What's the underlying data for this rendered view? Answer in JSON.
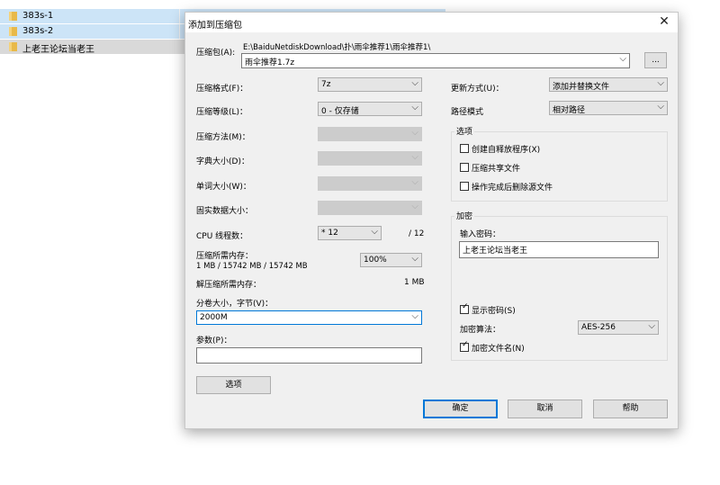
{
  "explorer": {
    "files": [
      {
        "name": "383s-1"
      },
      {
        "name": "383s-2"
      },
      {
        "name": "上老王论坛当老王"
      }
    ]
  },
  "dialog": {
    "title": "添加到压缩包",
    "archive_label": "压缩包(A):",
    "archive_path": "E:\\BaiduNetdiskDownload\\扑\\雨伞推荐1\\雨伞推荐1\\",
    "archive_name": "雨伞推荐1.7z",
    "browse_label": "...",
    "format_label": "压缩格式(F)：",
    "format_value": "7z",
    "level_label": "压缩等级(L)：",
    "level_value": "0 - 仅存储",
    "method_label": "压缩方法(M)：",
    "dict_label": "字典大小(D)：",
    "word_label": "单词大小(W)：",
    "solid_label": "固实数据大小：",
    "cpu_label": "CPU 线程数：",
    "cpu_value": "* 12",
    "cpu_max": "/ 12",
    "mem_comp_label": "压缩所需内存：",
    "mem_comp_value": "1 MB / 15742 MB / 15742 MB",
    "mem_percent": "100%",
    "mem_decomp_label": "解压缩所需内存：",
    "mem_decomp_value": "1 MB",
    "split_label": "分卷大小，字节(V)：",
    "split_value": "2000M",
    "params_label": "参数(P)：",
    "params_value": "",
    "options_btn": "选项",
    "update_label": "更新方式(U)：",
    "update_value": "添加并替换文件",
    "path_label": "路径模式",
    "path_value": "相对路径",
    "options_group": "选项",
    "opt_sfx": "创建自释放程序(X)",
    "opt_shared": "压缩共享文件",
    "opt_delete": "操作完成后删除源文件",
    "enc_group": "加密",
    "password_label": "输入密码：",
    "password_value": "上老王论坛当老王",
    "show_password": "显示密码(S)",
    "enc_method_label": "加密算法：",
    "enc_method_value": "AES-256",
    "enc_names": "加密文件名(N)",
    "ok": "确定",
    "cancel": "取消",
    "help": "帮助"
  },
  "colors": {
    "selection": "#cce4f7",
    "folder": "#e8b94a",
    "accent": "#0078d7",
    "dialog_bg": "#f0f0f0"
  },
  "icons": {
    "folder": "folder-icon",
    "close": "close-icon",
    "dropdown": "chevron-down-icon",
    "check": "checkmark-icon"
  }
}
